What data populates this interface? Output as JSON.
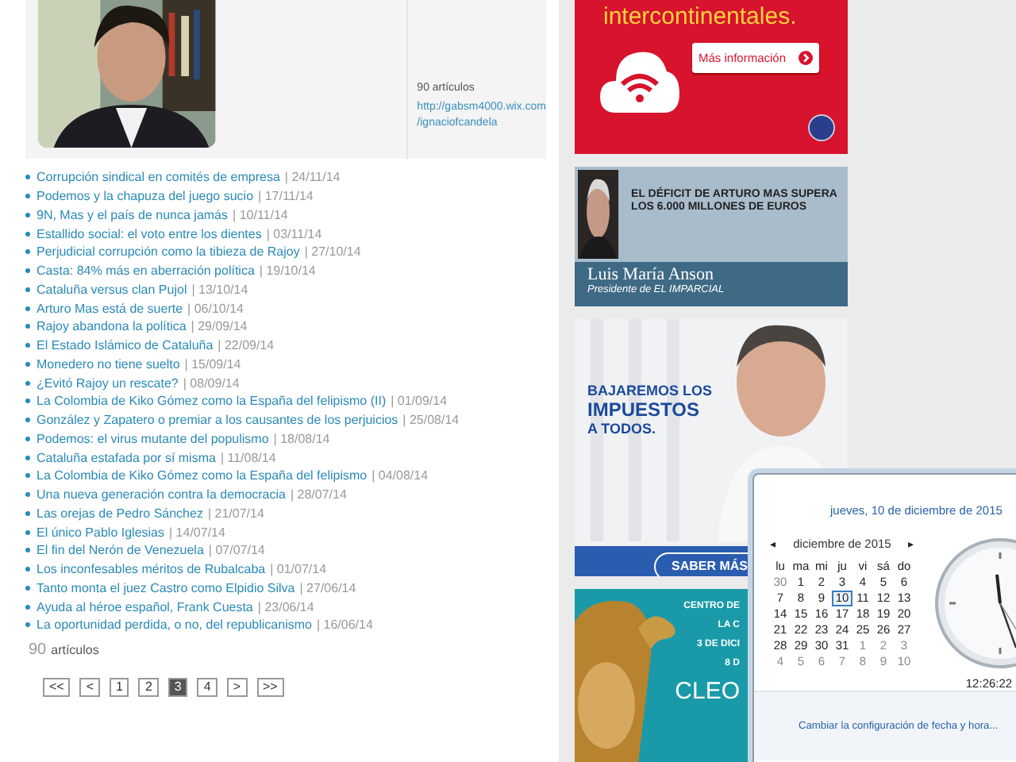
{
  "profile": {
    "count": "90 artículos",
    "links": [
      "http://gabsm4000.wix.com",
      "/ignaciofcandela"
    ]
  },
  "articles": [
    {
      "title": "Corrupción sindical en comités de empresa",
      "date": "| 24/11/14"
    },
    {
      "title": "Podemos y la chapuza del juego sucio",
      "date": "| 17/11/14"
    },
    {
      "title": "9N, Mas y el país de nunca jamás",
      "date": "| 10/11/14"
    },
    {
      "title": "Estallido social: el voto entre los dientes",
      "date": "| 03/11/14"
    },
    {
      "title": "Perjudicial corrupción como la tibieza de Rajoy",
      "date": "| 27/10/14"
    },
    {
      "title": "Casta: 84% más en aberración política",
      "date": "| 19/10/14"
    },
    {
      "title": "Cataluña versus clan Pujol",
      "date": "| 13/10/14"
    },
    {
      "title": "Arturo Mas está de suerte",
      "date": "| 06/10/14"
    },
    {
      "title": "Rajoy abandona la política",
      "date": "| 29/09/14"
    },
    {
      "title": "El Estado Islámico de Cataluña",
      "date": "| 22/09/14"
    },
    {
      "title": "Monedero no tiene suelto",
      "date": "| 15/09/14"
    },
    {
      "title": "¿Evitó Rajoy un rescate?",
      "date": "| 08/09/14"
    },
    {
      "title": "La Colombia de Kiko Gómez como la España del felipismo (II)",
      "date": "| 01/09/14"
    },
    {
      "title": "González y Zapatero o premiar a los causantes de los perjuicios",
      "date": "| 25/08/14"
    },
    {
      "title": "Podemos: el virus mutante del populismo",
      "date": "| 18/08/14"
    },
    {
      "title": "Cataluña estafada por sí misma",
      "date": "| 11/08/14"
    },
    {
      "title": "La Colombia de Kiko Gómez como la España del felipismo",
      "date": "| 04/08/14"
    },
    {
      "title": "Una nueva generación contra la democracia",
      "date": "| 28/07/14"
    },
    {
      "title": "Las orejas de Pedro Sánchez",
      "date": "| 21/07/14"
    },
    {
      "title": "El único Pablo Iglesias",
      "date": "| 14/07/14"
    },
    {
      "title": "El fin del Nerón de Venezuela",
      "date": "| 07/07/14"
    },
    {
      "title": "Los inconfesables méritos de Rubalcaba",
      "date": "| 01/07/14"
    },
    {
      "title": "Tanto monta el juez Castro como Elpidio Silva",
      "date": "| 27/06/14"
    },
    {
      "title": "Ayuda al héroe español, Frank Cuesta",
      "date": "| 23/06/14"
    },
    {
      "title": "La oportunidad perdida, o no, del republicanismo",
      "date": "| 16/06/14"
    }
  ],
  "total": {
    "number": "90",
    "label": "artículos"
  },
  "pagination": [
    {
      "label": "<<",
      "selected": false
    },
    {
      "label": "<",
      "selected": false
    },
    {
      "label": "1",
      "selected": false
    },
    {
      "label": "2",
      "selected": false
    },
    {
      "label": "3",
      "selected": true
    },
    {
      "label": "4",
      "selected": false
    },
    {
      "label": ">",
      "selected": false
    },
    {
      "label": ">>",
      "selected": false
    }
  ],
  "ads": {
    "red": {
      "headline": "intercontinentales.",
      "button": "Más información"
    },
    "anson": {
      "headline": "EL DÉFICIT DE ARTURO MAS SUPERA LOS 6.000 MILLONES DE EUROS",
      "name": "Luis María Anson",
      "role": "Presidente de EL IMPARCIAL"
    },
    "campaign": {
      "lines": [
        "BAJAREMOS LOS",
        "IMPUESTOS",
        "A TODOS."
      ],
      "button": "SABER MÁS"
    },
    "exhibit": {
      "lines": [
        "CENTRO DE",
        "LA C",
        "3 DE DICI",
        "8 D"
      ],
      "logo": "CLEO"
    }
  },
  "calendar": {
    "date_heading": "jueves, 10 de diciembre de 2015",
    "prev": "◂",
    "month": "diciembre de 2015",
    "next": "▸",
    "weekdays": [
      "lu",
      "ma",
      "mi",
      "ju",
      "vi",
      "sá",
      "do"
    ],
    "days": [
      {
        "label": "30",
        "other_month": true,
        "selected": false
      },
      {
        "label": "1",
        "other_month": false,
        "selected": false
      },
      {
        "label": "2",
        "other_month": false,
        "selected": false
      },
      {
        "label": "3",
        "other_month": false,
        "selected": false
      },
      {
        "label": "4",
        "other_month": false,
        "selected": false
      },
      {
        "label": "5",
        "other_month": false,
        "selected": false
      },
      {
        "label": "6",
        "other_month": false,
        "selected": false
      },
      {
        "label": "7",
        "other_month": false,
        "selected": false
      },
      {
        "label": "8",
        "other_month": false,
        "selected": false
      },
      {
        "label": "9",
        "other_month": false,
        "selected": false
      },
      {
        "label": "10",
        "other_month": false,
        "selected": true
      },
      {
        "label": "11",
        "other_month": false,
        "selected": false
      },
      {
        "label": "12",
        "other_month": false,
        "selected": false
      },
      {
        "label": "13",
        "other_month": false,
        "selected": false
      },
      {
        "label": "14",
        "other_month": false,
        "selected": false
      },
      {
        "label": "15",
        "other_month": false,
        "selected": false
      },
      {
        "label": "16",
        "other_month": false,
        "selected": false
      },
      {
        "label": "17",
        "other_month": false,
        "selected": false
      },
      {
        "label": "18",
        "other_month": false,
        "selected": false
      },
      {
        "label": "19",
        "other_month": false,
        "selected": false
      },
      {
        "label": "20",
        "other_month": false,
        "selected": false
      },
      {
        "label": "21",
        "other_month": false,
        "selected": false
      },
      {
        "label": "22",
        "other_month": false,
        "selected": false
      },
      {
        "label": "23",
        "other_month": false,
        "selected": false
      },
      {
        "label": "24",
        "other_month": false,
        "selected": false
      },
      {
        "label": "25",
        "other_month": false,
        "selected": false
      },
      {
        "label": "26",
        "other_month": false,
        "selected": false
      },
      {
        "label": "27",
        "other_month": false,
        "selected": false
      },
      {
        "label": "28",
        "other_month": false,
        "selected": false
      },
      {
        "label": "29",
        "other_month": false,
        "selected": false
      },
      {
        "label": "30",
        "other_month": false,
        "selected": false
      },
      {
        "label": "31",
        "other_month": false,
        "selected": false
      },
      {
        "label": "1",
        "other_month": true,
        "selected": false
      },
      {
        "label": "2",
        "other_month": true,
        "selected": false
      },
      {
        "label": "3",
        "other_month": true,
        "selected": false
      },
      {
        "label": "4",
        "other_month": true,
        "selected": false
      },
      {
        "label": "5",
        "other_month": true,
        "selected": false
      },
      {
        "label": "6",
        "other_month": true,
        "selected": false
      },
      {
        "label": "7",
        "other_month": true,
        "selected": false
      },
      {
        "label": "8",
        "other_month": true,
        "selected": false
      },
      {
        "label": "9",
        "other_month": true,
        "selected": false
      },
      {
        "label": "10",
        "other_month": true,
        "selected": false
      }
    ],
    "time": "12:26:22",
    "settings_link": "Cambiar la configuración de fecha y hora..."
  }
}
